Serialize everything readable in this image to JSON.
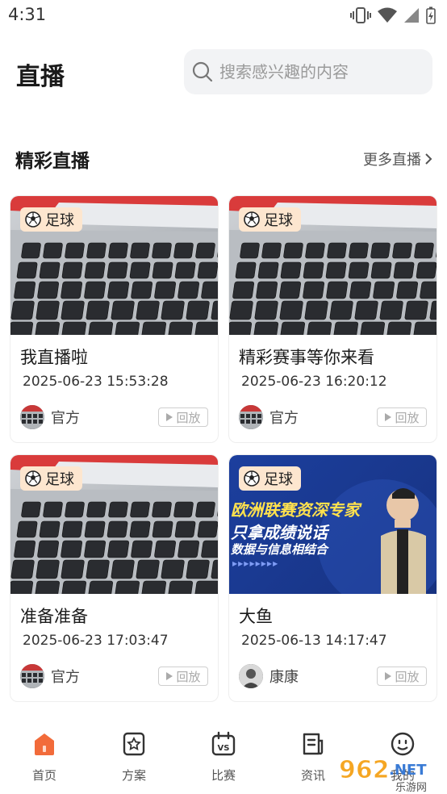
{
  "status": {
    "time": "4:31"
  },
  "header": {
    "title": "直播"
  },
  "search": {
    "placeholder": "搜索感兴趣的内容"
  },
  "section": {
    "title": "精彩直播",
    "more": "更多直播"
  },
  "cards": [
    {
      "tag": "足球",
      "title": "我直播啦",
      "time": "2025-06-23 15:53:28",
      "author": "官方",
      "replay": "回放",
      "thumb": "keyboard"
    },
    {
      "tag": "足球",
      "title": "精彩赛事等你来看",
      "time": "2025-06-23 16:20:12",
      "author": "官方",
      "replay": "回放",
      "thumb": "keyboard"
    },
    {
      "tag": "足球",
      "title": "准备准备",
      "time": "2025-06-23 17:03:47",
      "author": "官方",
      "replay": "回放",
      "thumb": "keyboard"
    },
    {
      "tag": "足球",
      "title": "大鱼",
      "time": "2025-06-13 14:17:47",
      "author": "康康",
      "replay": "回放",
      "thumb": "banner",
      "banner": {
        "line1": "欧洲联赛资深专家",
        "line2": "只拿成绩说话",
        "line3": "数据与信息相结合"
      }
    }
  ],
  "tabs": [
    {
      "label": "首页",
      "icon": "home-icon",
      "active": true
    },
    {
      "label": "方案",
      "icon": "star-doc-icon",
      "active": false
    },
    {
      "label": "比赛",
      "icon": "vs-calendar-icon",
      "active": false
    },
    {
      "label": "资讯",
      "icon": "news-icon",
      "active": false
    },
    {
      "label": "我的",
      "icon": "smile-icon",
      "active": false
    }
  ],
  "colors": {
    "accent": "#f26b3a",
    "tag_bg": "#fde6cf",
    "banner_bg": "#1a3e9a",
    "banner_text": "#ffe14d"
  },
  "watermark": {
    "text": "962",
    "suffix": ".NET",
    "sub": "乐游网"
  }
}
